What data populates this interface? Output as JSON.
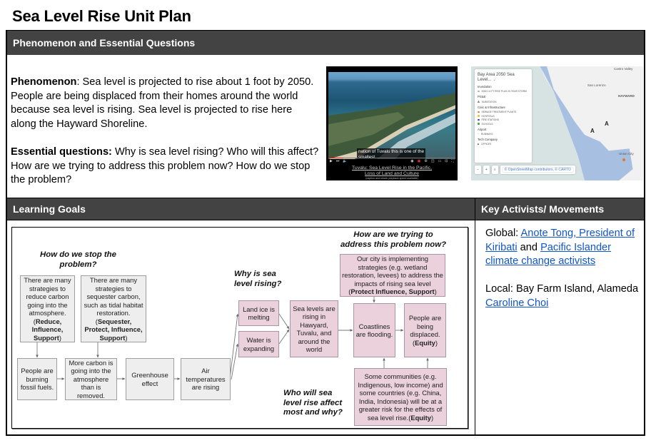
{
  "page_title": "Sea Level Rise Unit Plan",
  "phenomenon_section": {
    "header": "Phenomenon and Essential Questions",
    "phenomenon_label": "Phenomenon",
    "phenomenon_text": ": Sea level is projected to rise about 1 foot by 2050. People are being displaced from their homes around the world because sea level is rising. Sea level is projected to rise here along the Hayward Shoreline.",
    "questions_label": "Essential questions:",
    "questions_text": " Why is sea level rising? Who will this affect? How are we trying to address this problem now? How do we stop the problem?",
    "video": {
      "caption_overlay": "nation of Tuvalu this is one of the\nsmallest",
      "link_text": "Tuvalu: Sea Level Rise in the Pacific,\nLoss of Land and Culture",
      "note": "(caption and slower playback speed available)",
      "progress_fraction": 0.12
    },
    "map": {
      "legend_title": "Bay Area 2050 Sea Level...",
      "groups": [
        {
          "name": "Inundation",
          "items": [
            {
              "label": "2050 1.6 FT RISE PLUS 20-YEAR STORM",
              "color": "#8fb3e0"
            }
          ]
        },
        {
          "name": "PG&E",
          "items": [
            {
              "label": "SUBSTATION",
              "glyph": "A"
            }
          ]
        },
        {
          "name": "Civic & Infrastructure",
          "items": [
            {
              "label": "SEWAGE TREATMENT PLANTS",
              "color": "#e8762d"
            },
            {
              "label": "HOSPITALS",
              "color": "#e8c42d"
            },
            {
              "label": "FIRE STATIONS",
              "color": "#2d3fc4"
            },
            {
              "label": "SCHOOLS",
              "color": "#3fa83f"
            }
          ]
        },
        {
          "name": "Airport",
          "items": [
            {
              "label": "RUNWAYS",
              "glyph": "+"
            }
          ]
        },
        {
          "name": "Tech Company",
          "items": [
            {
              "label": "OFFICES",
              "glyph": "■"
            }
          ]
        }
      ],
      "places": {
        "castro_valley": "Castro Valley",
        "san_lorenzo": "San Lorenzo",
        "hayward": "HAYWARD",
        "union_city": "Union City"
      },
      "attribution": "© OpenStreetMap contributors, © CARTO",
      "zoom_out": "−",
      "zoom_in": "+",
      "search": "⌕"
    }
  },
  "learning_goals": {
    "header": "Learning Goals",
    "diagram": {
      "questions": {
        "stop": "How do we stop the\nproblem?",
        "why": "Why is sea\nlevel rising?",
        "address": "How are we trying to\naddress this problem now?",
        "who": "Who will sea\nlevel rise affect\nmost and why?"
      },
      "boxes": {
        "reduce": {
          "body": "There are many\nstrategies to\nreduce carbon\ngoing into the\natmosphere.\n(",
          "tag": "Reduce,\nInfluence,\nSupport",
          "end": ")"
        },
        "sequester": {
          "body": "There are many\nstrategies to\nsequester carbon,\nsuch as tidal habitat\nrestoration.\n(",
          "tag": "Sequester,\nProtect, Influence,\nSupport",
          "end": ")"
        },
        "burning": {
          "body": "People are\nburning\nfossil fuels."
        },
        "more_carbon": {
          "body": "More carbon is\ngoing into the\natmosphere\nthan is\nremoved."
        },
        "greenhouse": {
          "body": "Greenhouse\neffect"
        },
        "air_temps": {
          "body": "Air\ntemperatures\nare rising"
        },
        "land_ice": {
          "body": "Land ice is\nmelting"
        },
        "water_expanding": {
          "body": "Water is\nexpanding"
        },
        "sea_levels": {
          "body": "Sea levels are\nrising in\nHawyard,\nTuvalu, and\naround the\nworld"
        },
        "coastlines": {
          "body": "Coastlines\nare flooding."
        },
        "displaced": {
          "body": "People are\nbeing\ndisplaced.\n(",
          "tag": "Equity",
          "end": ")"
        },
        "city": {
          "body": "Our city is implementing\nstrategies (e.g. wetland\nrestoration, levees) to address the\nimpacts of rising sea level\n(",
          "tag": "Protect Influence, Support",
          "end": ")"
        },
        "communities": {
          "body": "Some communities (e.g.\nIndigenous, low income) and\nsome countries (e.g. China,\nIndia, Indonesia) will be at a\ngreater risk for the effects of\nsea level rise.(",
          "tag": "Equity",
          "end": ")"
        }
      }
    }
  },
  "activists": {
    "header": "Key Activists/ Movements",
    "global_label": "Global: ",
    "global_link_1": "Anote Tong, President of Kiribati",
    "global_and": " and ",
    "global_link_2": "Pacific Islander climate change activists",
    "local_label": "Local: Bay Farm Island, Alameda ",
    "local_link": "Caroline Choi"
  }
}
